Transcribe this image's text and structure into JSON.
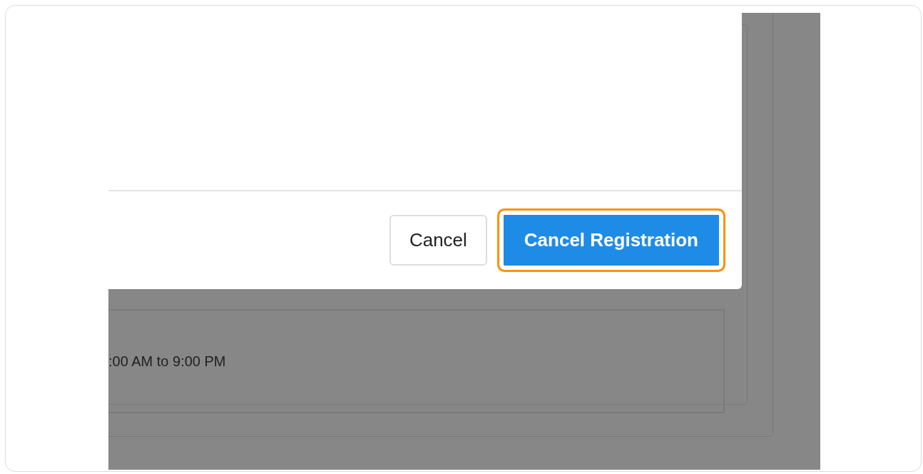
{
  "dialog": {
    "buttons": [
      {
        "label": "Cancel",
        "kind": "secondary",
        "highlighted": false
      },
      {
        "label": "Cancel Registration",
        "kind": "primary",
        "highlighted": true
      }
    ]
  },
  "background": {
    "time_text": ":00 AM to 9:00 PM"
  }
}
